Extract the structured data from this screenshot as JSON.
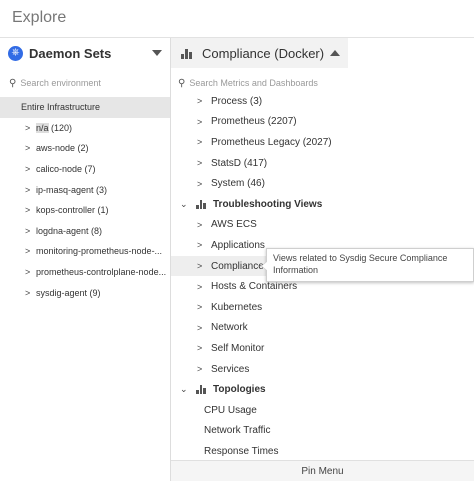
{
  "header": {
    "title": "Explore"
  },
  "scope": {
    "title": "Daemon Sets",
    "search_placeholder": "Search environment",
    "items": [
      {
        "label": "Entire Infrastructure"
      },
      {
        "label_highlight": "n/a",
        "label_rest": " (120)"
      },
      {
        "label": "aws-node (2)"
      },
      {
        "label": "calico-node (7)"
      },
      {
        "label": "ip-masq-agent (3)"
      },
      {
        "label": "kops-controller (1)"
      },
      {
        "label": "logdna-agent (8)"
      },
      {
        "label": "monitoring-prometheus-node-..."
      },
      {
        "label": "prometheus-controlplane-node..."
      },
      {
        "label": "sysdig-agent (9)"
      }
    ]
  },
  "metrics": {
    "title": "Compliance (Docker)",
    "search_placeholder": "Search Metrics and Dashboards",
    "items": [
      {
        "label": "Process (3)"
      },
      {
        "label": "Prometheus (2207)"
      },
      {
        "label": "Prometheus Legacy (2027)"
      },
      {
        "label": "StatsD (417)"
      },
      {
        "label": "System (46)"
      },
      {
        "label": "Troubleshooting Views"
      },
      {
        "label": "AWS ECS"
      },
      {
        "label": "Applications"
      },
      {
        "label": "Compliance"
      },
      {
        "label": "Hosts & Containers"
      },
      {
        "label": "Kubernetes"
      },
      {
        "label": "Network"
      },
      {
        "label": "Self Monitor"
      },
      {
        "label": "Services"
      },
      {
        "label": "Topologies"
      },
      {
        "label": "CPU Usage"
      },
      {
        "label": "Network Traffic"
      },
      {
        "label": "Response Times"
      }
    ],
    "pin_menu": "Pin Menu"
  },
  "tooltip": {
    "text": "Views related to Sysdig Secure Compliance Information"
  },
  "colors": {
    "kubernetes_blue": "#326ce5",
    "selected_bg": "#e6e6e6",
    "hover_bg": "#eeeeee"
  },
  "icons": [
    "kubernetes-icon",
    "search-icon",
    "bar-chart-icon",
    "chevron-right-icon",
    "chevron-down-icon",
    "caret-down-icon",
    "caret-up-icon"
  ]
}
